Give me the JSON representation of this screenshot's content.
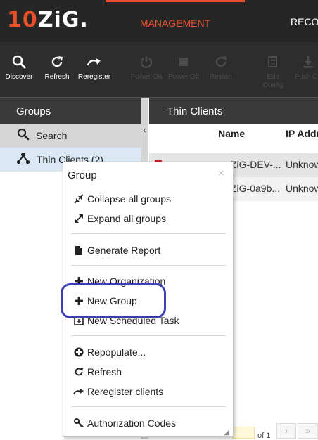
{
  "logo": {
    "one": "10",
    "rest": "ZiG."
  },
  "top_tabs": {
    "management": "MANAGEMENT",
    "recovery": "RECOV"
  },
  "toolbar": {
    "discover": "Discover",
    "refresh": "Refresh",
    "reregister": "Reregister",
    "power_on": "Power On",
    "power_off": "Power Off",
    "restart": "Restart",
    "edit_config": "Edit\nConfig",
    "push": "Push Co"
  },
  "sidebar": {
    "header": "Groups",
    "search": "Search",
    "thin_clients": "Thin Clients (2)"
  },
  "main": {
    "header": "Thin Clients",
    "columns": {
      "name": "Name",
      "ip": "IP Addr"
    },
    "rows": [
      {
        "name": "ZiG-DEV-...",
        "ip": "Unknow"
      },
      {
        "name": "ZiG-0a9b...",
        "ip": "Unknow"
      }
    ]
  },
  "pager": {
    "of": "of 1",
    "next": "›",
    "last": "»"
  },
  "context_menu": {
    "title": "Group",
    "close": "×",
    "items": {
      "collapse_all": "Collapse all groups",
      "expand_all": "Expand all groups",
      "generate_report": "Generate Report",
      "new_organization": "New Organization",
      "new_group": "New Group",
      "new_scheduled_task": "New Scheduled Task",
      "repopulate": "Repopulate...",
      "refresh": "Refresh",
      "reregister_clients": "Reregister clients",
      "authorization_codes": "Authorization Codes"
    }
  },
  "colors": {
    "accent": "#e8502a",
    "topbar": "#262626",
    "toolbar": "#2d2d2d",
    "panel_header": "#3a3a3a",
    "selected_group": "#dae8f5",
    "highlight": "#3c3fb4"
  },
  "icons": {
    "discover": "search-icon",
    "refresh": "refresh-icon",
    "reregister": "redo-icon",
    "power_on": "power-icon",
    "power_off": "stop-icon",
    "restart": "restart-icon",
    "edit_config": "edit-icon",
    "push": "download-icon",
    "thin_clients": "hierarchy-icon"
  }
}
